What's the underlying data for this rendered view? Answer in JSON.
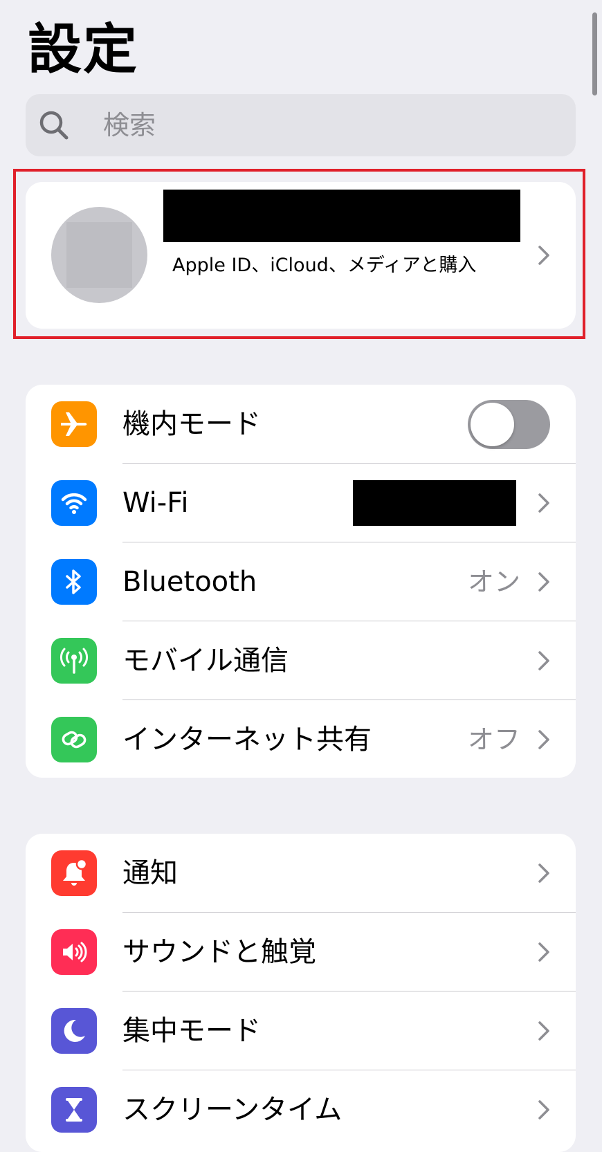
{
  "header": {
    "title": "設定"
  },
  "search": {
    "placeholder": "検索"
  },
  "profile": {
    "subtitle": "Apple ID、iCloud、メディアと購入"
  },
  "groups": [
    {
      "rows": [
        {
          "label": "機内モード",
          "icon": "airplane-icon",
          "color": "#ff9500",
          "control": "toggle-off"
        },
        {
          "label": "Wi-Fi",
          "icon": "wifi-icon",
          "color": "#007aff",
          "value": ""
        },
        {
          "label": "Bluetooth",
          "icon": "bluetooth-icon",
          "color": "#007aff",
          "value": "オン"
        },
        {
          "label": "モバイル通信",
          "icon": "antenna-icon",
          "color": "#34c759",
          "value": ""
        },
        {
          "label": "インターネット共有",
          "icon": "hotspot-icon",
          "color": "#34c759",
          "value": "オフ"
        }
      ]
    },
    {
      "rows": [
        {
          "label": "通知",
          "icon": "bell-icon",
          "color": "#ff3b30"
        },
        {
          "label": "サウンドと触覚",
          "icon": "speaker-icon",
          "color": "#ff2d55"
        },
        {
          "label": "集中モード",
          "icon": "moon-icon",
          "color": "#5856d6"
        },
        {
          "label": "スクリーンタイム",
          "icon": "hourglass-icon",
          "color": "#5856d6"
        }
      ]
    }
  ]
}
